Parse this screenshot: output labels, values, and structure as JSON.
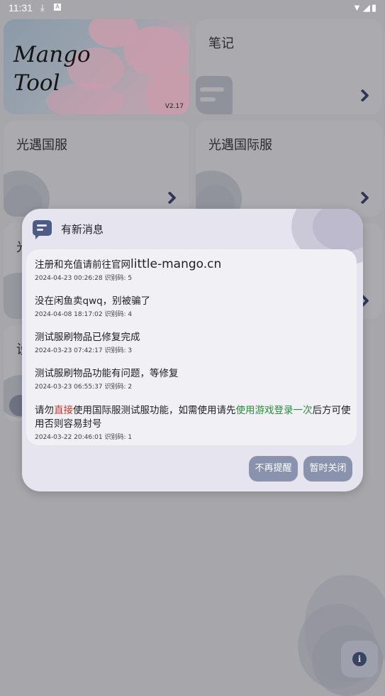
{
  "status_bar": {
    "time": "11:31"
  },
  "banner": {
    "logo_line1": "Mango",
    "logo_line2": "Tool",
    "version": "V2.17"
  },
  "cards": {
    "notes": "笔记",
    "sky_cn": "光遇国服",
    "sky_intl": "光遇国际服",
    "partial_1": "光",
    "partial_2": "设"
  },
  "dialog": {
    "title": "有新消息",
    "messages": [
      {
        "pre": "注册和充值请前往官网",
        "link": "little-mango.cn",
        "meta": "2024-04-23 00:26:28 识别码: 5"
      },
      {
        "text": "没在闲鱼卖qwq，别被骗了",
        "meta": "2024-04-08 18:17:02 识别码: 4"
      },
      {
        "text": "测试服刷物品已修复完成",
        "meta": "2024-03-23 07:42:17 识别码: 3"
      },
      {
        "text": "测试服刷物品功能有问题，等修复",
        "meta": "2024-03-23 06:55:37 识别码: 2"
      },
      {
        "a": "请勿",
        "red": "直接",
        "b": "使用国际服测试服功能，如需使用请先",
        "green": "使用游戏登录一次",
        "c": "后方可使用否则容易封号",
        "meta": "2024-03-22 20:46:01 识别码: 1"
      }
    ],
    "btn_never": "不再提醒",
    "btn_close": "暂时关闭"
  },
  "icons": {
    "download": "download-icon",
    "notification": "a-badge-icon",
    "wifi": "wifi-icon",
    "signal": "signal-icon",
    "battery": "battery-icon",
    "info": "info-icon",
    "message": "message-icon"
  },
  "colors": {
    "accent": "#8a93ad",
    "dialog_bg": "#e6e4ee",
    "red": "#c0392b",
    "green": "#2e8b3d"
  }
}
